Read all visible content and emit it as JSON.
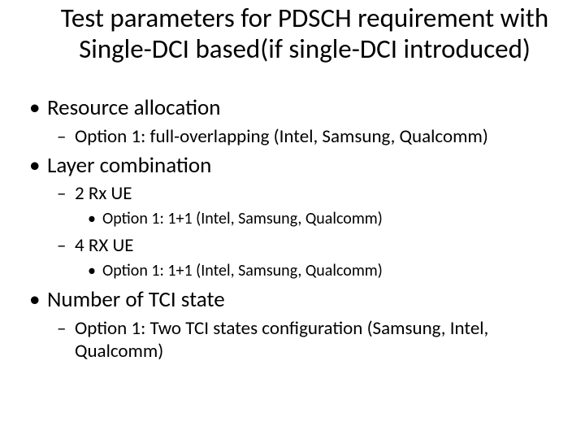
{
  "title": "Test parameters for PDSCH requirement with Single-DCI based(if single-DCI introduced)",
  "b1": "Resource allocation",
  "b1_1": "Option 1: full-overlapping (Intel, Samsung, Qualcomm)",
  "b2": "Layer combination",
  "b2_1": "2 Rx UE",
  "b2_1_1": "Option 1: 1+1 (Intel, Samsung, Qualcomm)",
  "b2_2": "4 RX UE",
  "b2_2_1": "Option 1: 1+1 (Intel, Samsung, Qualcomm)",
  "b3": "Number of TCI state",
  "b3_1": "Option 1: Two TCI states configuration (Samsung, Intel, Qualcomm)"
}
